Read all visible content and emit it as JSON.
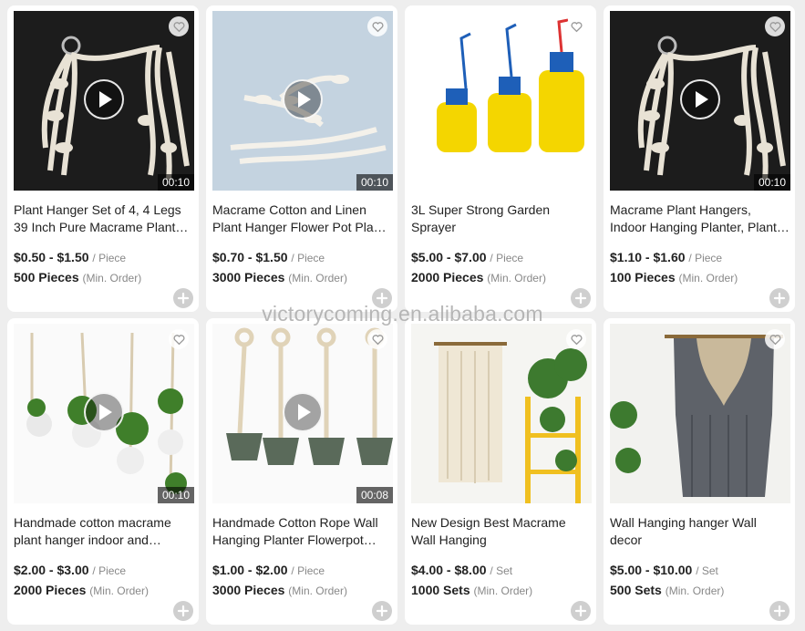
{
  "watermark": "victorycoming.en.alibaba.com",
  "colors": {
    "background": "#eeeeee",
    "card": "#ffffff",
    "text": "#222222",
    "muted": "#888888"
  },
  "products": [
    {
      "title": "Plant Hanger Set of 4, 4 Legs 39 Inch Pure Macrame Plant Hanger Indoor Outdoor",
      "price": "$0.50 - $1.50",
      "unit": "/ Piece",
      "moq": "500 Pieces",
      "moq_note": "(Min. Order)",
      "video": true,
      "duration": "00:10",
      "image": "macrame-hanger-dark"
    },
    {
      "title": "Macrame Cotton and Linen Plant Hanger Flower Pot Plant Holder",
      "price": "$0.70 - $1.50",
      "unit": "/ Piece",
      "moq": "3000 Pieces",
      "moq_note": "(Min. Order)",
      "video": true,
      "duration": "00:10",
      "image": "macrame-hanger-blue"
    },
    {
      "title": "3L Super Strong Garden Sprayer",
      "price": "$5.00 - $7.00",
      "unit": "/ Piece",
      "moq": "2000 Pieces",
      "moq_note": "(Min. Order)",
      "video": false,
      "duration": "",
      "image": "garden-sprayers"
    },
    {
      "title": "Macrame Plant Hangers, Indoor Hanging Planter, Plant Holder",
      "price": "$1.10 - $1.60",
      "unit": "/ Piece",
      "moq": "100 Pieces",
      "moq_note": "(Min. Order)",
      "video": true,
      "duration": "00:10",
      "image": "macrame-hanger-dark"
    },
    {
      "title": "Handmade cotton macrame plant hanger indoor and outdoor",
      "price": "$2.00 - $3.00",
      "unit": "/ Piece",
      "moq": "2000 Pieces",
      "moq_note": "(Min. Order)",
      "video": true,
      "duration": "00:10",
      "image": "hangers-with-plants"
    },
    {
      "title": "Handmade Cotton Rope Wall Hanging Planter Flowerpot Holder",
      "price": "$1.00 - $2.00",
      "unit": "/ Piece",
      "moq": "3000 Pieces",
      "moq_note": "(Min. Order)",
      "video": true,
      "duration": "00:08",
      "image": "rope-hangers-pots"
    },
    {
      "title": "New Design Best Macrame Wall Hanging",
      "price": "$4.00 - $8.00",
      "unit": "/ Set",
      "moq": "1000 Sets",
      "moq_note": "(Min. Order)",
      "video": false,
      "duration": "",
      "image": "wall-hanging-shelf"
    },
    {
      "title": "Wall Hanging hanger Wall decor",
      "price": "$5.00 - $10.00",
      "unit": "/ Set",
      "moq": "500 Sets",
      "moq_note": "(Min. Order)",
      "video": false,
      "duration": "",
      "image": "wall-hanging-gray"
    }
  ]
}
